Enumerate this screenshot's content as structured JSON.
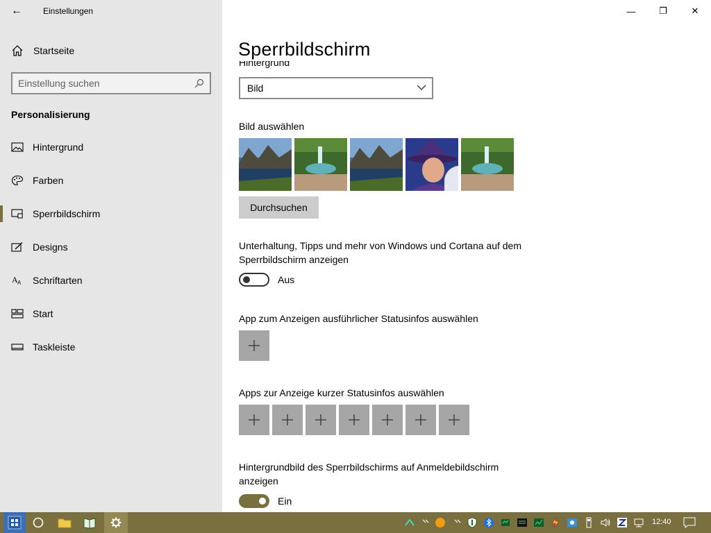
{
  "window": {
    "app_title": "Einstellungen",
    "back_label": "←",
    "minimize_glyph": "—",
    "maximize_glyph": "❐",
    "close_glyph": "✕"
  },
  "sidebar": {
    "home_label": "Startseite",
    "search_placeholder": "Einstellung suchen",
    "section_title": "Personalisierung",
    "items": [
      {
        "label": "Hintergrund",
        "icon": "image-icon",
        "selected": false
      },
      {
        "label": "Farben",
        "icon": "palette-icon",
        "selected": false
      },
      {
        "label": "Sperrbildschirm",
        "icon": "lock-screen-icon",
        "selected": true
      },
      {
        "label": "Designs",
        "icon": "brush-icon",
        "selected": false
      },
      {
        "label": "Schriftarten",
        "icon": "font-icon",
        "selected": false
      },
      {
        "label": "Start",
        "icon": "start-icon",
        "selected": false
      },
      {
        "label": "Taskleiste",
        "icon": "taskbar-icon",
        "selected": false
      }
    ]
  },
  "main": {
    "page_title": "Sperrbildschirm",
    "background_label": "Hintergrund",
    "background_dropdown_value": "Bild",
    "choose_picture_label": "Bild auswählen",
    "browse_button": "Durchsuchen",
    "fun_facts_label": "Unterhaltung, Tipps und mehr von Windows und Cortana auf dem Sperrbildschirm anzeigen",
    "fun_facts_state": "Aus",
    "detailed_status_label": "App zum Anzeigen ausführlicher Statusinfos auswählen",
    "quick_status_label": "Apps zur Anzeige kurzer Statusinfos auswählen",
    "quick_status_slots": 7,
    "signin_bg_label": "Hintergrundbild des Sperrbildschirms auf Anmeldebildschirm anzeigen",
    "signin_bg_state": "Ein"
  },
  "taskbar": {
    "clock": "12:40",
    "accent": "#7a6f3f"
  },
  "colors": {
    "accent": "#7a6f3f",
    "sidebar_bg": "#e6e6e6",
    "button_bg": "#cccccc",
    "plus_bg": "#a6a6a6"
  }
}
